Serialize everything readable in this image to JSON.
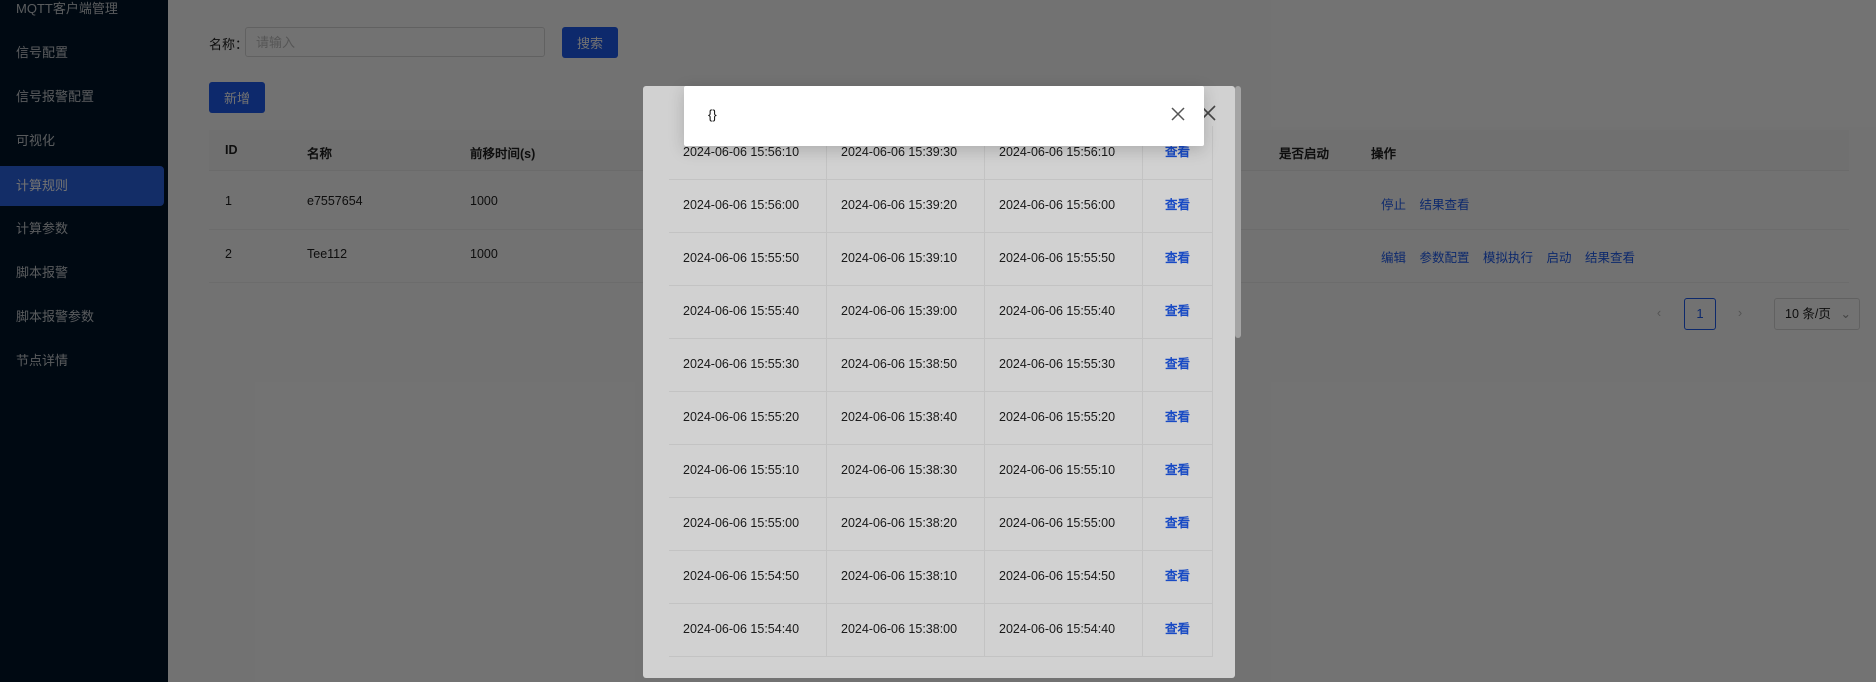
{
  "sidebar": {
    "items": [
      {
        "label": "MQTT客户端管理"
      },
      {
        "label": "信号配置"
      },
      {
        "label": "信号报警配置"
      },
      {
        "label": "可视化"
      },
      {
        "label": "计算规则",
        "active": true
      },
      {
        "label": "计算参数"
      },
      {
        "label": "脚本报警"
      },
      {
        "label": "脚本报警参数"
      },
      {
        "label": "节点详情"
      }
    ]
  },
  "search": {
    "label": "名称：",
    "placeholder": "请输入",
    "value": "",
    "button": "搜索"
  },
  "toolbar": {
    "add_label": "新增"
  },
  "table": {
    "columns": [
      "ID",
      "名称",
      "前移时间(s)",
      "是否启动",
      "操作"
    ],
    "rows": [
      {
        "id": "1",
        "name": "e7557654",
        "shift": "1000",
        "actions": [
          "停止",
          "结果查看"
        ]
      },
      {
        "id": "2",
        "name": "Tee112",
        "shift": "1000",
        "actions": [
          "编辑",
          "参数配置",
          "模拟执行",
          "启动",
          "结果查看"
        ]
      }
    ]
  },
  "pagination": {
    "prev": "‹",
    "current": "1",
    "next": "›",
    "page_size": "10 条/页"
  },
  "result_modal": {
    "close_icon": "close-icon",
    "rows": [
      {
        "c1": "2024-06-06 15:56:10",
        "c2": "2024-06-06 15:39:30",
        "c3": "2024-06-06 15:56:10",
        "action": "查看"
      },
      {
        "c1": "2024-06-06 15:56:00",
        "c2": "2024-06-06 15:39:20",
        "c3": "2024-06-06 15:56:00",
        "action": "查看"
      },
      {
        "c1": "2024-06-06 15:55:50",
        "c2": "2024-06-06 15:39:10",
        "c3": "2024-06-06 15:55:50",
        "action": "查看"
      },
      {
        "c1": "2024-06-06 15:55:40",
        "c2": "2024-06-06 15:39:00",
        "c3": "2024-06-06 15:55:40",
        "action": "查看"
      },
      {
        "c1": "2024-06-06 15:55:30",
        "c2": "2024-06-06 15:38:50",
        "c3": "2024-06-06 15:55:30",
        "action": "查看"
      },
      {
        "c1": "2024-06-06 15:55:20",
        "c2": "2024-06-06 15:38:40",
        "c3": "2024-06-06 15:55:20",
        "action": "查看"
      },
      {
        "c1": "2024-06-06 15:55:10",
        "c2": "2024-06-06 15:38:30",
        "c3": "2024-06-06 15:55:10",
        "action": "查看"
      },
      {
        "c1": "2024-06-06 15:55:00",
        "c2": "2024-06-06 15:38:20",
        "c3": "2024-06-06 15:55:00",
        "action": "查看"
      },
      {
        "c1": "2024-06-06 15:54:50",
        "c2": "2024-06-06 15:38:10",
        "c3": "2024-06-06 15:54:50",
        "action": "查看"
      },
      {
        "c1": "2024-06-06 15:54:40",
        "c2": "2024-06-06 15:38:00",
        "c3": "2024-06-06 15:54:40",
        "action": "查看"
      }
    ]
  },
  "detail_modal": {
    "content": "{}",
    "close_icon": "close-icon"
  }
}
